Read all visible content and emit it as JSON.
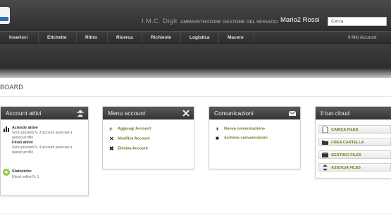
{
  "header": {
    "org": "I.M.C. Digit",
    "role": "AMMINISTRATORE GESTORE DEL SERVIZIO",
    "user": "Mario2 Rossi",
    "search_placeholder": "Cerca"
  },
  "nav": {
    "items": [
      "Inserisci",
      "Etichette",
      "Ritiro",
      "Ricerca",
      "Richieste",
      "Logistica",
      "Macero"
    ],
    "account": "Il Mio Account"
  },
  "page": {
    "title": "BOARD"
  },
  "cards": {
    "account_attivi": {
      "title": "Account attivi",
      "aziende_title": "Aziende attive",
      "aziende_line1": "Sono presenti N. 3 account associati a",
      "aziende_line2": "questo profilo",
      "filiali_title": "Filiali attive",
      "filiali_line1": "Sono presenti N. 4 account associati a",
      "filiali_line2": "questo profilo",
      "stats_title": "Statistiche",
      "stats_line": "Utenti online N. 1"
    },
    "menu_account": {
      "title": "Menu account",
      "items": [
        "Aggiungi Account",
        "Modifica Account",
        "Elimina Account"
      ]
    },
    "comunicazioni": {
      "title": "Comunicazioni",
      "items": [
        "Nuova comunicazione",
        "Archivio comunicazioni"
      ]
    },
    "cloud": {
      "title": "Il tuo cloud",
      "items": [
        "CARICA FILES",
        "CREA CARTELLA",
        "GESTISCI FILES",
        "ASSOCIA FILES"
      ]
    }
  },
  "colors": {
    "link": "#6e7a1a",
    "header": "#333333",
    "stats_badge": "#8dc63f"
  },
  "icons": {
    "account_attivi": "users-icon",
    "menu_account": "tools-icon",
    "comunicazioni": "envelope-icon",
    "cloud_items": [
      "file-upload-icon",
      "folder-icon",
      "files-manage-icon",
      "associate-icon"
    ]
  }
}
